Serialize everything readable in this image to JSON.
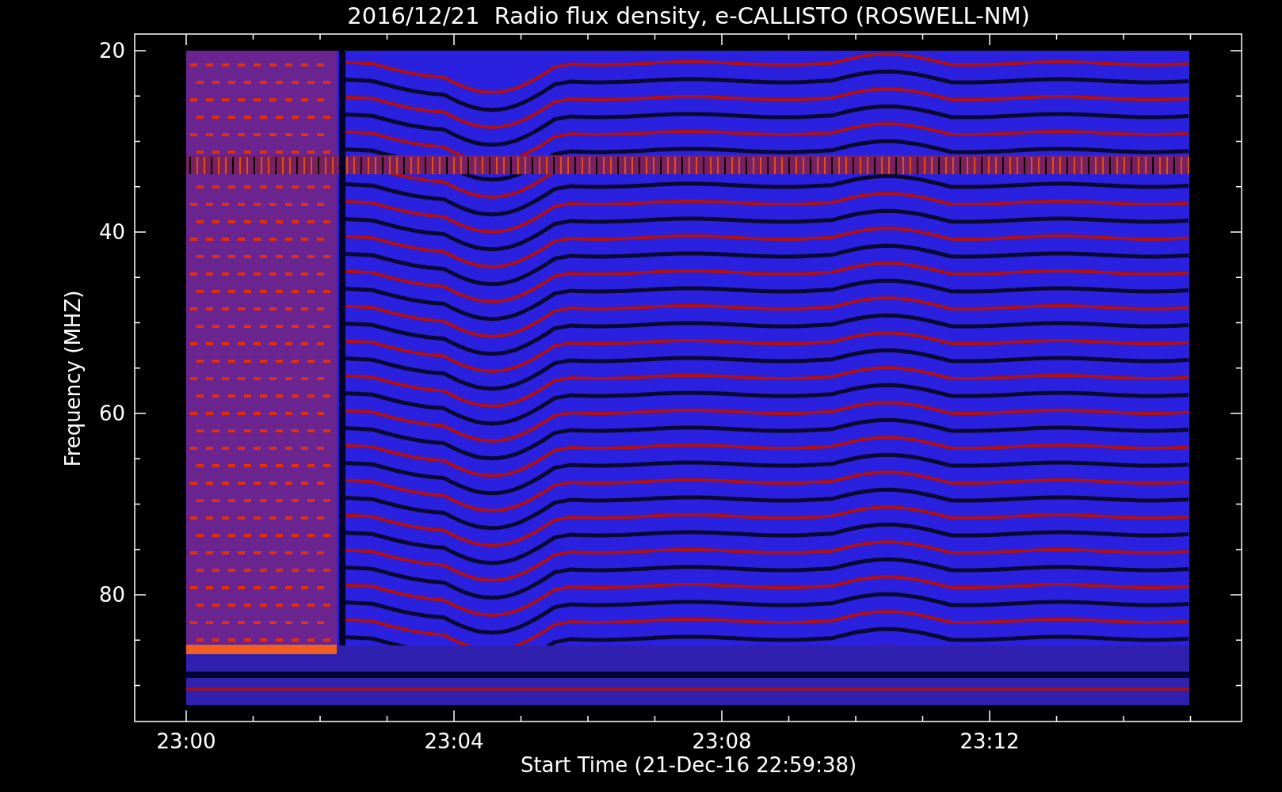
{
  "plot": {
    "title": "2016/12/21  Radio flux density, e-CALLISTO (ROSWELL-NM)",
    "xlabel": "Start Time (21-Dec-16 22:59:38)",
    "ylabel": "Frequency (MHZ)",
    "xticks": [
      "23:00",
      "23:04",
      "23:08",
      "23:12"
    ],
    "yticks": [
      "20",
      "40",
      "60",
      "80"
    ]
  }
}
